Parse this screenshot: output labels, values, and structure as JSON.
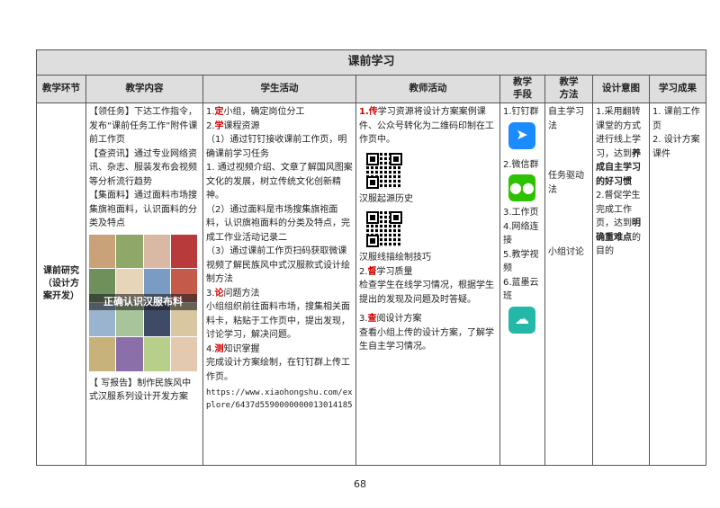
{
  "title": "课前学习",
  "headers": [
    "教学环节",
    "教学内容",
    "学生活动",
    "教师活动",
    "教学\n手段",
    "教学\n方法",
    "设计意图",
    "学习成果"
  ],
  "stage": [
    "课前研究",
    "（设计方",
    "案开发）"
  ],
  "content": {
    "p1_tag": "【领任务】",
    "p1_text": "下达工作指令，发布“课前任务工作”附件课前工作页",
    "p2_tag": "【查资讯】",
    "p2_text": "通过专业网络资讯、杂志、服装发布会视频等分析流行趋势",
    "p3_tag": "【集面料】",
    "p3_text": "通过面料市场搜集旗袍面料，认识面料的分类及特点",
    "image_caption": "正确认识汉服布料",
    "p4_tag": "【 写报告】",
    "p4_text": "制作民族风中式汉服系列设计开发方案"
  },
  "student": {
    "s1_num": "1.",
    "s1_key": "定",
    "s1_text": "小组，确定岗位分工",
    "s2_num": "2.",
    "s2_key": "学",
    "s2_text": "课程资源",
    "s2_a": "（1）通过钉钉接收课前工作页，明确课前学习任务",
    "s2_b": "1. 通过视频介绍、文章了解国风图案文化的发展，树立传统文化创新精神。",
    "s2_c": "（2）通过面料是市场搜集旗袍面料，认识旗袍面料的分类及特点，完成工作业活动记录二",
    "s2_d": "（3）通过课前工作页扫码获取微课视频了解民族风中式汉服款式设计绘制方法",
    "s3_num": "3.",
    "s3_key": "论",
    "s3_text": "问题方法",
    "s3_a": "小组组织前往面料市场，搜集相关面料卡，粘贴于工作页中，提出发现，讨论学习，解决问题。",
    "s4_num": "4.",
    "s4_key": "测",
    "s4_text": "知识掌握",
    "s4_a": "完成设计方案绘制，在钉钉群上传工作页。",
    "url": "https://www.xiaohongshu.com/explore/6437d5590000000013014185"
  },
  "teacher": {
    "t1_num": "1.",
    "t1_key": "传",
    "t1_text": "学习资源将设计方案案例课件、公众号转化为二维码印制在工作页中。",
    "qr1_label": "汉服起源历史",
    "qr2_label": "汉服线描绘制技巧",
    "t2_num": "2.",
    "t2_key": "督",
    "t2_text": "学习质量",
    "t2_a": "检查学生在线学习情况，根据学生提出的发现及问题及时答疑。",
    "t3_num": "3.",
    "t3_key": "查",
    "t3_text": "阅设计方案",
    "t3_a": "查看小组上传的设计方案，了解学生自主学习情况。"
  },
  "means": {
    "m1": "1.钉钉群",
    "m2": "2.微信群",
    "m3": "3.工作页",
    "m4": "4.网络连接",
    "m5": "5.教学视频",
    "m6": "6.蓝墨云班"
  },
  "methods": {
    "a": "自主学习法",
    "b": "任务驱动法",
    "c": "小组讨论"
  },
  "intent": {
    "i1_a": "1.采用翻转课堂的方式进行线上学习，达到",
    "i1_b": "养成自主学习的好习惯",
    "i2_a": "2.督促学生完成工作页，达到",
    "i2_b": "明确重难点",
    "i2_c": "的目的"
  },
  "outcome": {
    "o1": "1. 课前工作页",
    "o2": "2. 设计方案课件"
  },
  "page_number": "68",
  "colors": {
    "header_bg": "#dedede",
    "accent_red": "#d40000",
    "dingtalk_blue": "#1a8cff",
    "wechat_green": "#2dc100",
    "mosoink_teal": "#24b8a8"
  }
}
